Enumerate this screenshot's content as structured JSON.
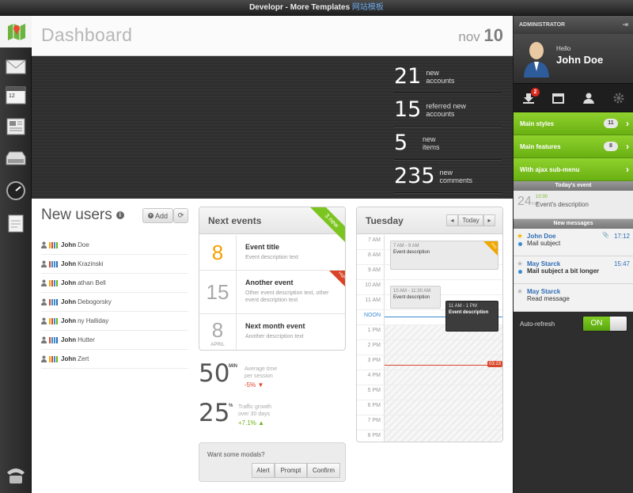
{
  "window": {
    "title": "Developr - More Templates",
    "title_cn": "网站模板"
  },
  "header": {
    "title": "Dashboard",
    "month": "nov",
    "day": "10"
  },
  "stats": [
    {
      "value": "21",
      "label1": "new",
      "label2": "accounts"
    },
    {
      "value": "15",
      "label1": "referred new",
      "label2": "accounts"
    },
    {
      "value": "5",
      "label1": "new",
      "label2": "items"
    },
    {
      "value": "235",
      "label1": "new",
      "label2": "comments"
    }
  ],
  "users": {
    "title": "New users",
    "add_label": "Add",
    "list": [
      {
        "bold": "John",
        "rest": "Doe"
      },
      {
        "bold": "John",
        "rest": "Krazinski"
      },
      {
        "bold": "John",
        "rest": "athan Bell"
      },
      {
        "bold": "John",
        "rest": "Debogorsky"
      },
      {
        "bold": "John",
        "rest": "ny Halliday"
      },
      {
        "bold": "John",
        "rest": "Hutter"
      },
      {
        "bold": "John",
        "rest": "Zert"
      }
    ]
  },
  "events": {
    "title": "Next events",
    "ribbon": "3 new",
    "items": [
      {
        "day": "8",
        "month": "",
        "title": "Event title",
        "desc": "Event description text",
        "corner": ""
      },
      {
        "day": "15",
        "month": "",
        "title": "Another event",
        "desc": "Other event description text, other event description text",
        "corner": "High"
      },
      {
        "day": "8",
        "month": "APRIL",
        "title": "Next month event",
        "desc": "Another description text",
        "corner": ""
      }
    ]
  },
  "metrics": {
    "session": {
      "value": "50",
      "unit": "MIN",
      "desc1": "Average time",
      "desc2": "per session",
      "change": "-5% ▼"
    },
    "traffic": {
      "value": "25",
      "unit": "%",
      "desc1": "Traffic growth",
      "desc2": "over 30 days",
      "change": "+7.1% ▲"
    }
  },
  "modals": {
    "label": "Want some modals?",
    "alert": "Alert",
    "prompt": "Prompt",
    "confirm": "Confirm"
  },
  "calendar": {
    "title": "Tuesday",
    "today_label": "Today",
    "hours": [
      "7 AM",
      "8 AM",
      "9 AM",
      "10 AM",
      "11 AM",
      "NOON",
      "1 PM",
      "2 PM",
      "3 PM",
      "4 PM",
      "5 PM",
      "6 PM",
      "7 PM",
      "8 PM"
    ],
    "now": "03:23",
    "events": [
      {
        "time": "7 AM - 9 AM",
        "title": "Event description",
        "tag": "Pro"
      },
      {
        "time": "10 AM - 11:30 AM",
        "title": "Event description"
      },
      {
        "time": "11 AM - 1 PM",
        "title": "Event description"
      }
    ]
  },
  "sidebar": {
    "role": "ADMINISTRATOR",
    "hello": "Hello",
    "name": "John Doe",
    "inbox_count": "2",
    "menu": [
      {
        "label": "Main styles",
        "count": "11"
      },
      {
        "label": "Main features",
        "count": "8"
      },
      {
        "label": "With ajax sub-menu",
        "count": ""
      }
    ],
    "today_title": "Today's event",
    "today_event": {
      "day": "24",
      "month": "Feb",
      "time": "10:30",
      "desc": "Event's description"
    },
    "messages_title": "New messages",
    "messages": [
      {
        "from": "John Doe",
        "subject": "Mail subject",
        "time": "17:12",
        "starred": true,
        "unread": false
      },
      {
        "from": "May Starck",
        "subject": "Mail subject a bit longer",
        "time": "15:47",
        "starred": false,
        "unread": true
      },
      {
        "from": "May Starck",
        "subject": "Read message",
        "time": "",
        "starred": false,
        "unread": false
      }
    ],
    "autorefresh_label": "Auto-refresh",
    "toggle_label": "ON"
  },
  "colors": {
    "accent_green": "#7cc41f",
    "accent_red": "#d9472b",
    "link_blue": "#2f6db5"
  }
}
